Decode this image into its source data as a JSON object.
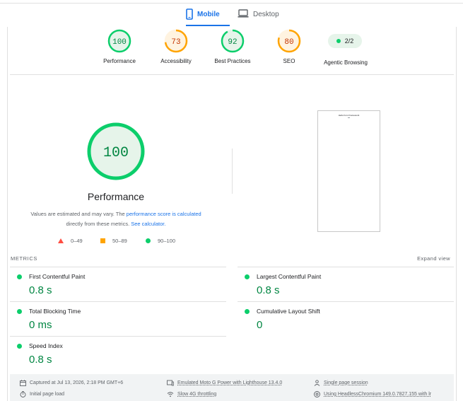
{
  "tabs": [
    {
      "label": "Mobile",
      "icon": "smartphone-icon",
      "selected": true
    },
    {
      "label": "Desktop",
      "icon": "laptop-icon",
      "selected": false
    }
  ],
  "colors": {
    "pass": "#0cce6b",
    "average": "#ffa400",
    "fail": "#ff4e42",
    "accent": "#1a73e8",
    "pass_text": "#018642",
    "average_text": "#c33300"
  },
  "summary": {
    "gauges": [
      {
        "label": "Performance",
        "score": "100",
        "value": 100
      },
      {
        "label": "Accessibility",
        "score": "73",
        "value": 73
      },
      {
        "label": "Best Practices",
        "score": "92",
        "value": 92
      },
      {
        "label": "SEO",
        "score": "80",
        "value": 80
      }
    ],
    "agentic": {
      "score": "2/2",
      "label": "Agentic Browsing"
    }
  },
  "performance": {
    "score": "100",
    "value": 100,
    "title": "Performance",
    "note_prefix": "Values are estimated and may vary. The ",
    "note_link": "performance score is calculated",
    "note_mid": "directly from these metrics. ",
    "note_link2": "See calculator.",
    "legend": [
      {
        "range": "0–49"
      },
      {
        "range": "50–89"
      },
      {
        "range": "90–100"
      }
    ],
    "screenshot_text": "Hello from Framework"
  },
  "metrics": {
    "title": "METRICS",
    "expand": "Expand view",
    "items": [
      {
        "name": "First Contentful Paint",
        "value": "0.8 s"
      },
      {
        "name": "Largest Contentful Paint",
        "value": "0.8 s"
      },
      {
        "name": "Total Blocking Time",
        "value": "0 ms"
      },
      {
        "name": "Cumulative Layout Shift",
        "value": "0"
      },
      {
        "name": "Speed Index",
        "value": "0.8 s"
      }
    ]
  },
  "runtime": {
    "captured": "Captured at Jul 13, 2026, 2:18 PM GMT+6",
    "page_load": "Initial page load",
    "device": "Emulated Moto G Power with Lighthouse 13.4.0",
    "throttling": "Slow 4G throttling",
    "session": "Single page session",
    "browser": "Using HeadlessChromium 149.0.7827.155 with lr"
  }
}
